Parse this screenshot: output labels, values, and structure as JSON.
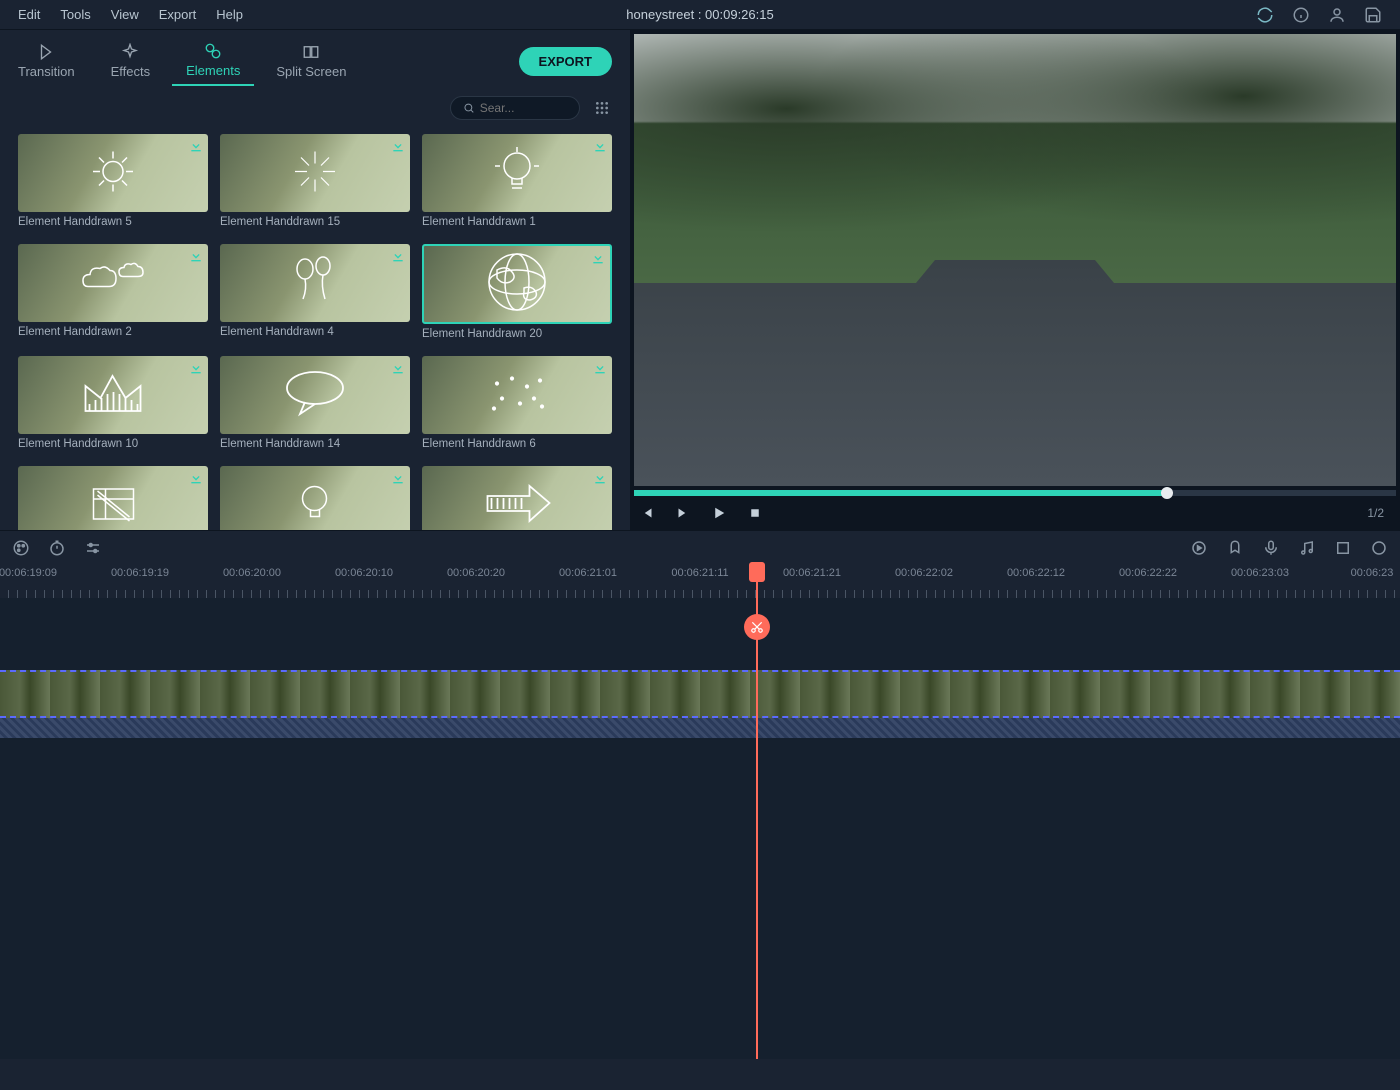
{
  "menu": [
    "Edit",
    "Tools",
    "View",
    "Export",
    "Help"
  ],
  "project_title": "honeystreet : 00:09:26:15",
  "tabs": [
    {
      "id": "transition",
      "label": "Transition"
    },
    {
      "id": "effects",
      "label": "Effects"
    },
    {
      "id": "elements",
      "label": "Elements"
    },
    {
      "id": "splitscreen",
      "label": "Split Screen"
    }
  ],
  "active_tab": "elements",
  "export_label": "EXPORT",
  "search": {
    "placeholder": "Sear..."
  },
  "elements": [
    {
      "label": "Element Handdrawn 5",
      "doodle": "sun"
    },
    {
      "label": "Element Handdrawn 15",
      "doodle": "burst"
    },
    {
      "label": "Element Handdrawn 1",
      "doodle": "bulb"
    },
    {
      "label": "Element Handdrawn 2",
      "doodle": "clouds"
    },
    {
      "label": "Element Handdrawn 4",
      "doodle": "balloons"
    },
    {
      "label": "Element Handdrawn 20",
      "doodle": "globe",
      "selected": true
    },
    {
      "label": "Element Handdrawn 10",
      "doodle": "crown"
    },
    {
      "label": "Element Handdrawn 14",
      "doodle": "speech"
    },
    {
      "label": "Element Handdrawn 6",
      "doodle": "sparkle"
    },
    {
      "label": "",
      "doodle": "doc"
    },
    {
      "label": "",
      "doodle": "bulb2"
    },
    {
      "label": "",
      "doodle": "arrow"
    }
  ],
  "playback": {
    "page": "1/2"
  },
  "ruler": [
    "00:06:19:09",
    "00:06:19:19",
    "00:06:20:00",
    "00:06:20:10",
    "00:06:20:20",
    "00:06:21:01",
    "00:06:21:11",
    "00:06:21:21",
    "00:06:22:02",
    "00:06:22:12",
    "00:06:22:22",
    "00:06:23:03",
    "00:06:23"
  ],
  "playhead_pct": 54,
  "colors": {
    "accent": "#2ed3b7",
    "playhead": "#ff6b5a"
  }
}
